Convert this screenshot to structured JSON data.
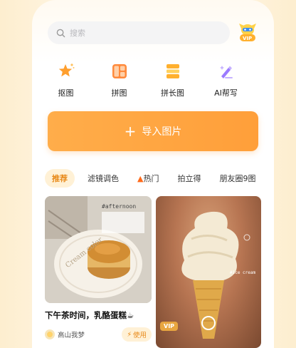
{
  "search": {
    "placeholder": "搜索"
  },
  "vip": {
    "label": "VIP"
  },
  "tools": [
    {
      "label": "抠图",
      "icon": "star-cutout-icon"
    },
    {
      "label": "拼图",
      "icon": "collage-icon"
    },
    {
      "label": "拼长图",
      "icon": "long-image-icon"
    },
    {
      "label": "AI帮写",
      "icon": "ai-pen-icon"
    }
  ],
  "import_button": {
    "label": "导入图片"
  },
  "tabs": [
    {
      "label": "推荐",
      "active": true
    },
    {
      "label": "滤镜调色"
    },
    {
      "label": "热门"
    },
    {
      "label": "拍立得"
    },
    {
      "label": "朋友圈9图"
    }
  ],
  "cards": [
    {
      "photo_tag": "#afternoon",
      "cup_text": "Cream color",
      "title": "下午茶时间，乳酪蛋糕☕",
      "author": "高山我梦",
      "use_label": "使用"
    },
    {
      "photo_tag": "#ice cream",
      "badge": "VIP"
    }
  ],
  "colors": {
    "accent": "#ffa644",
    "accent_text": "#e88a1a",
    "tab_active_bg": "#fff1d6"
  }
}
